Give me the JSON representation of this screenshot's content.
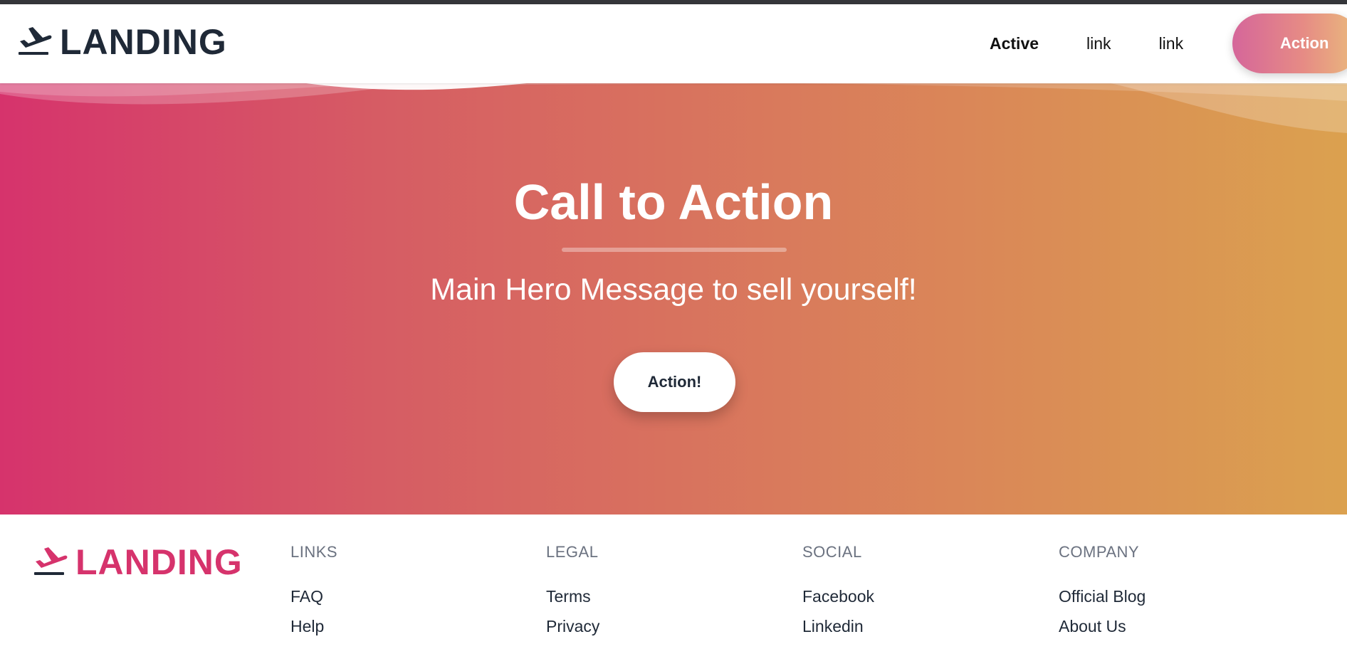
{
  "navbar": {
    "brand": "LANDING",
    "links": [
      {
        "label": "Active",
        "active": true
      },
      {
        "label": "link",
        "active": false
      },
      {
        "label": "link",
        "active": false
      }
    ],
    "action_label": "Action"
  },
  "hero": {
    "title": "Call to Action",
    "message": "Main Hero Message to sell yourself!",
    "button_label": "Action!"
  },
  "footer": {
    "brand": "LANDING",
    "columns": [
      {
        "heading": "LINKS",
        "links": [
          "FAQ",
          "Help"
        ]
      },
      {
        "heading": "LEGAL",
        "links": [
          "Terms",
          "Privacy"
        ]
      },
      {
        "heading": "SOCIAL",
        "links": [
          "Facebook",
          "Linkedin"
        ]
      },
      {
        "heading": "COMPANY",
        "links": [
          "Official Blog",
          "About Us"
        ]
      }
    ]
  },
  "colors": {
    "brand_dark": "#1f2937",
    "brand_pink": "#d6336c",
    "gradient_start": "#d6336c",
    "gradient_end": "#dba14f"
  },
  "icons": {
    "brand_icon": "plane-departure-icon"
  }
}
